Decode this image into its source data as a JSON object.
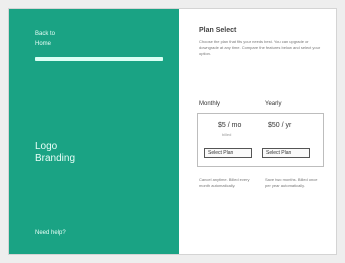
{
  "left": {
    "nav_back": "Back to",
    "nav_home": "Home",
    "progress": 1.0,
    "logo_line1": "Logo",
    "logo_line2": "Branding",
    "footer": "Need help?"
  },
  "right": {
    "title": "Plan Select",
    "description": "Choose the plan that fits your needs best. You can upgrade or downgrade at any time. Compare the features below and select your option.",
    "columns": [
      "Monthly",
      "Yearly"
    ],
    "cards": [
      {
        "price": "$5 / mo",
        "sub": "billed",
        "button": "Select Plan"
      },
      {
        "price": "$50 / yr",
        "button": "Select Plan"
      }
    ],
    "notes": [
      "Cancel anytime. Billed every month automatically.",
      "Save two months. Billed once per year automatically."
    ]
  },
  "colors": {
    "brand": "#1aa384",
    "panel": "#ffffff",
    "background": "#eeeeee"
  }
}
